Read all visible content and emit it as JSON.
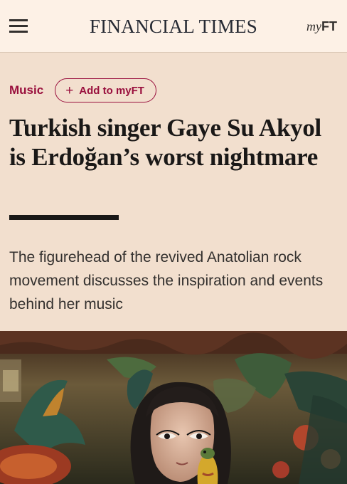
{
  "header": {
    "masthead": "FINANCIAL TIMES",
    "myft_prefix": "my",
    "myft_suffix": "FT",
    "menu_icon": "hamburger-menu-icon"
  },
  "article": {
    "topic": "Music",
    "add_to_myft_label": "Add to myFT",
    "add_icon": "plus-icon",
    "headline": "Turkish singer Gaye Su Akyol is Erdoğan’s worst nightmare",
    "standfirst": "The figurehead of the revived Anatolian rock movement discusses the inspiration and events behind her music"
  },
  "colors": {
    "page_background": "#f2dfce",
    "header_background": "#fdf1e6",
    "accent_claret": "#990f3d",
    "text_dark": "#1a1817"
  }
}
